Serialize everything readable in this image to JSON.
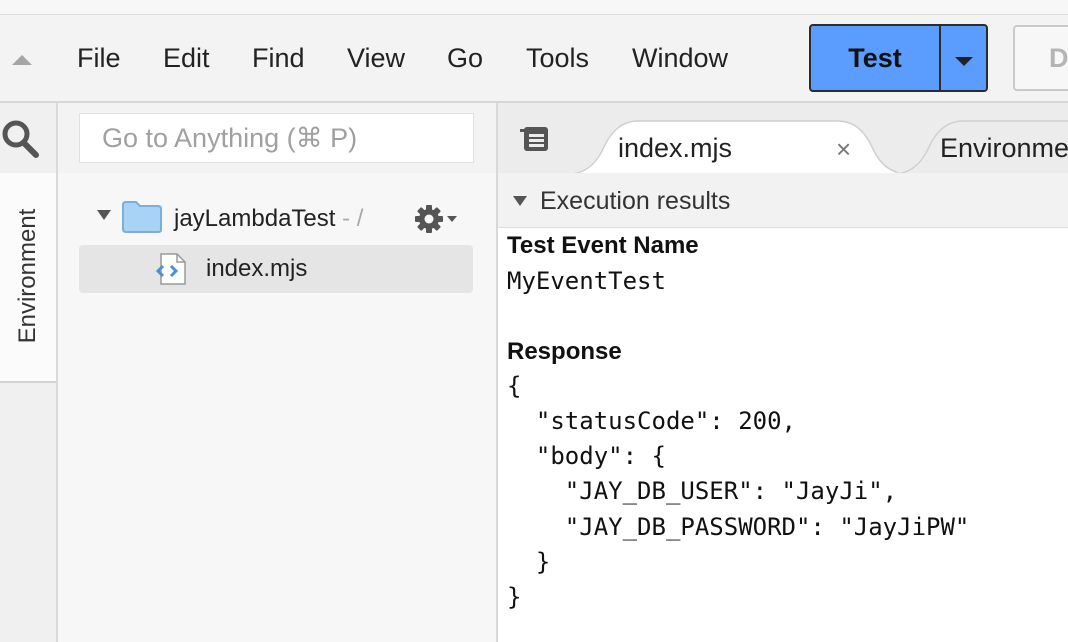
{
  "menu": {
    "items": [
      "File",
      "Edit",
      "Find",
      "View",
      "Go",
      "Tools",
      "Window"
    ],
    "test_label": "Test",
    "deploy_label": "D"
  },
  "sidebar": {
    "environment_label": "Environment"
  },
  "filepanel": {
    "goto_placeholder": "Go to Anything (⌘ P)",
    "folder_name": "jayLambdaTest",
    "folder_suffix": " - /",
    "file_name": "index.mjs"
  },
  "editor": {
    "tabs": [
      {
        "label": "index.mjs",
        "close": "×"
      },
      {
        "label": "Environment"
      }
    ],
    "results_title": "Execution results",
    "test_event_name_label": "Test Event Name",
    "test_event_name_value": "MyEventTest",
    "response_label": "Response",
    "response_lines": [
      "{",
      "  \"statusCode\": 200,",
      "  \"body\": {",
      "    \"JAY_DB_USER\": \"JayJi\",",
      "    \"JAY_DB_PASSWORD\": \"JayJiPW\"",
      "  }",
      "}"
    ]
  },
  "colors": {
    "test_button": "#5b9cff",
    "folder_icon": "#a9d3f5"
  },
  "icons": [
    "collapse-icon",
    "caret-down-icon",
    "search-icon",
    "folder-icon",
    "gear-icon",
    "file-code-icon",
    "tabs-menu-icon",
    "close-icon"
  ]
}
